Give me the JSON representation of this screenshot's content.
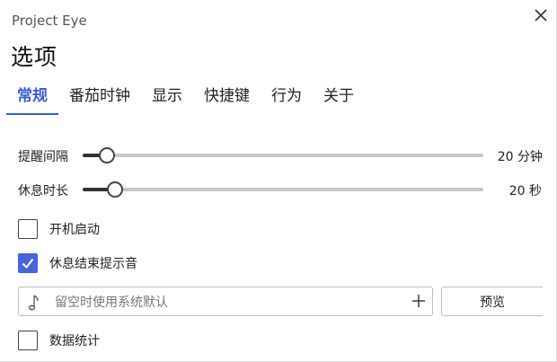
{
  "window": {
    "app_title": "Project Eye",
    "page_title": "选项"
  },
  "tabs": [
    {
      "label": "常规",
      "active": true
    },
    {
      "label": "番茄时钟",
      "active": false
    },
    {
      "label": "显示",
      "active": false
    },
    {
      "label": "快捷键",
      "active": false
    },
    {
      "label": "行为",
      "active": false
    },
    {
      "label": "关于",
      "active": false
    }
  ],
  "settings": {
    "remind_interval": {
      "label": "提醒间隔",
      "value_text": "20 分钟",
      "level": 0.06
    },
    "rest_duration": {
      "label": "休息时长",
      "value_text": "20 秒",
      "level": 0.08
    },
    "auto_start": {
      "label": "开机启动",
      "checked": false
    },
    "end_sound": {
      "label": "休息结束提示音",
      "checked": true
    },
    "sound_file": {
      "value": "",
      "placeholder": "留空时使用系统默认"
    },
    "preview_label": "预览",
    "statistics": {
      "label": "数据统计",
      "checked": false
    }
  },
  "colors": {
    "accent": "#3b5bd6",
    "checkbox_checked": "#4a63d8"
  },
  "icons": {
    "close": "close-icon",
    "note": "music-note-icon",
    "plus": "plus-icon",
    "check": "check-icon"
  }
}
